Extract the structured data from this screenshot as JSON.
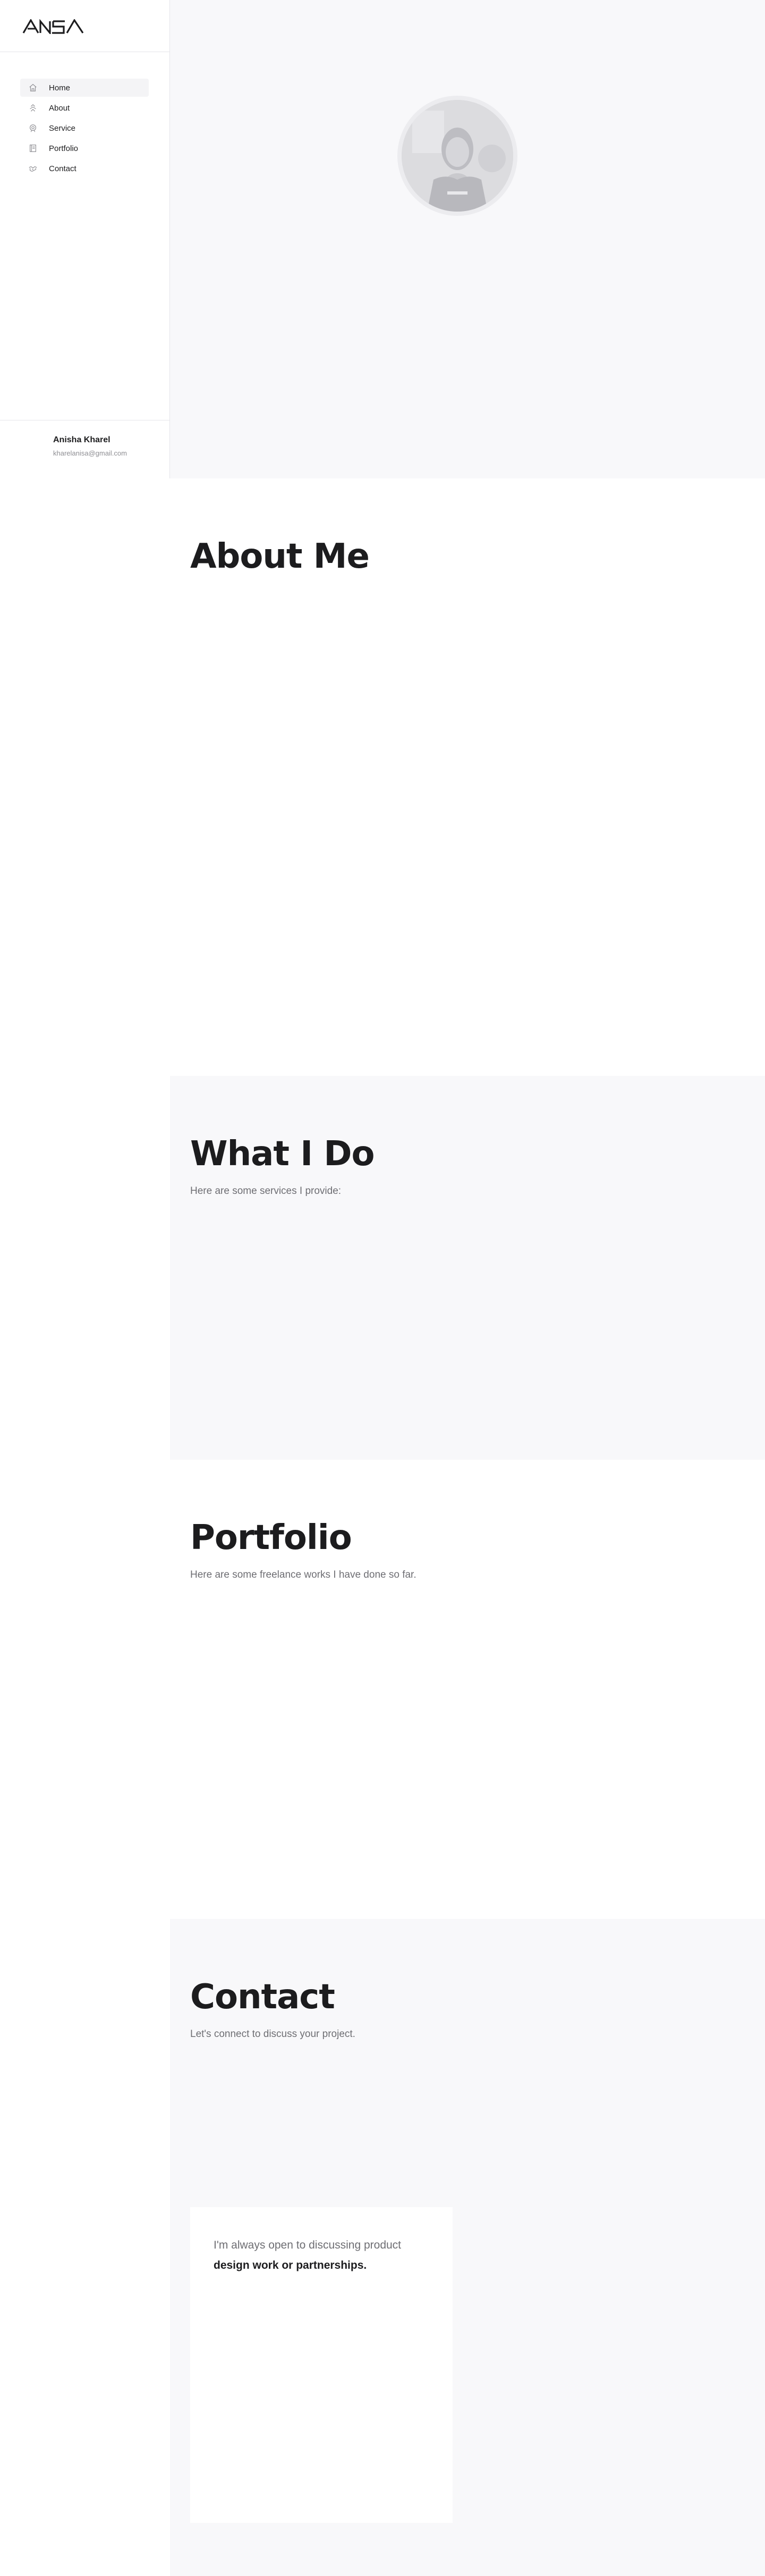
{
  "brand": {
    "logo_text": "ANSA"
  },
  "nav": {
    "items": [
      {
        "label": "Home",
        "icon": "home-icon",
        "active": true
      },
      {
        "label": "About",
        "icon": "user-icon",
        "active": false
      },
      {
        "label": "Service",
        "icon": "badge-icon",
        "active": false
      },
      {
        "label": "Portfolio",
        "icon": "book-icon",
        "active": false
      },
      {
        "label": "Contact",
        "icon": "handshake-icon",
        "active": false
      }
    ]
  },
  "profile": {
    "name": "Anisha Kharel",
    "email": "kharelanisa@gmail.com"
  },
  "hero": {
    "avatar": "profile-photo"
  },
  "about": {
    "title": "About Me"
  },
  "service": {
    "title": "What I Do",
    "subtitle": "Here are some services I provide:"
  },
  "portfolio": {
    "title": "Portfolio",
    "subtitle": "Here are some freelance works I have done so far."
  },
  "contact": {
    "title": "Contact",
    "subtitle": "Let's connect to discuss your project.",
    "card_line1": "I'm always open to discussing product",
    "card_line2": "design work or partnerships."
  },
  "colors": {
    "accent": "#1c1c1e",
    "muted": "#8e8e93",
    "panel": "#f8f8fa"
  }
}
